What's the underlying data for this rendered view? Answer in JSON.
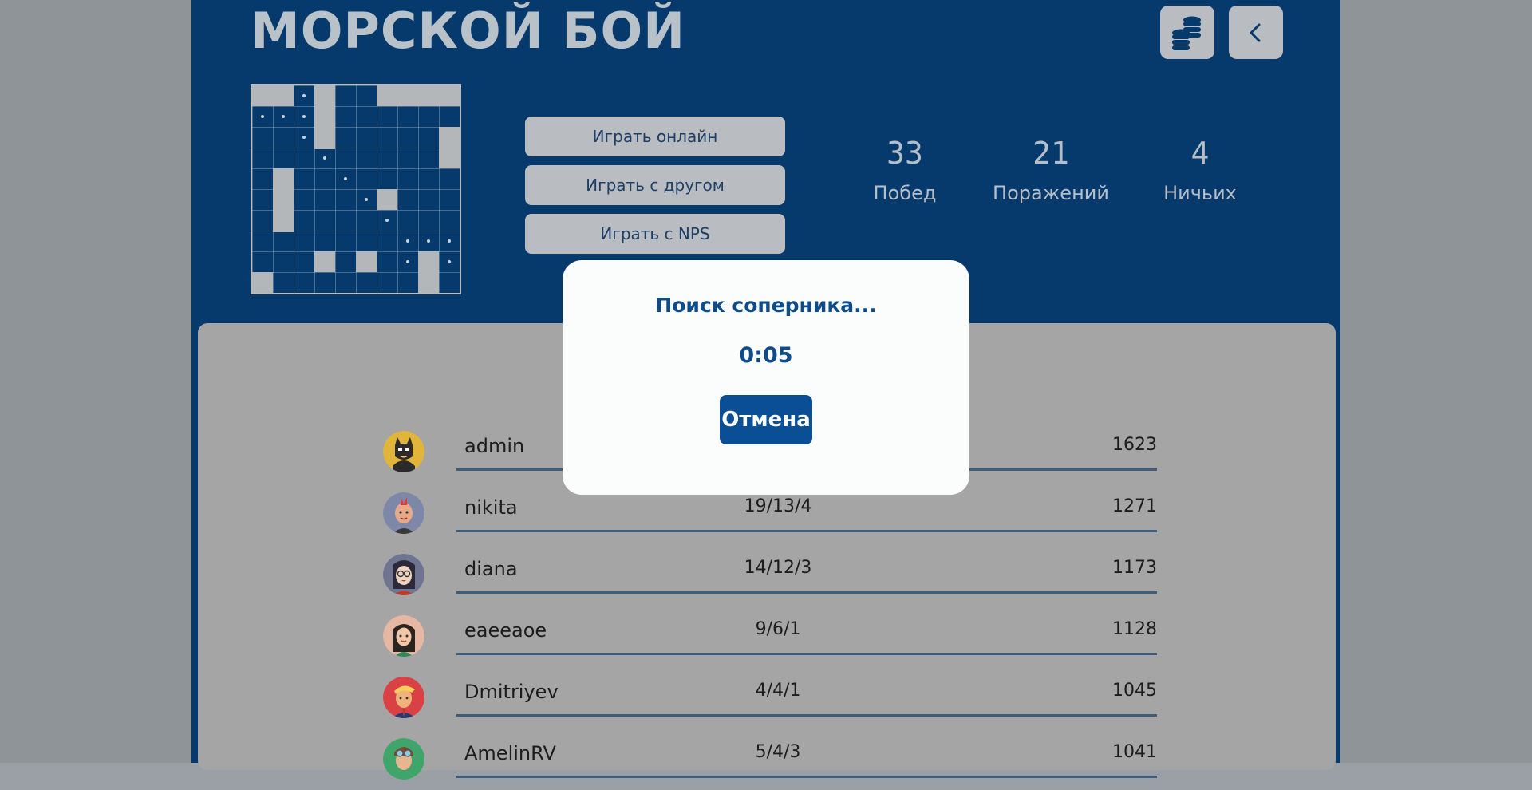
{
  "header": {
    "title": "МОРСКОЙ БОЙ",
    "coins_icon": "coins-icon",
    "back_icon": "chevron-left-icon"
  },
  "menu": {
    "play_online": "Играть онлайн",
    "play_friend": "Играть с другом",
    "play_nps": "Играть с NPS"
  },
  "stats": [
    {
      "value": "33",
      "label": "Побед"
    },
    {
      "value": "21",
      "label": "Поражений"
    },
    {
      "value": "4",
      "label": "Ничьих"
    }
  ],
  "leaderboard": [
    {
      "name": "admin",
      "games": "",
      "score": "1623",
      "avatar": "batman-avatar"
    },
    {
      "name": "nikita",
      "games": "19/13/4",
      "score": "1271",
      "avatar": "punk-avatar"
    },
    {
      "name": "diana",
      "games": "14/12/3",
      "score": "1173",
      "avatar": "glasses-avatar"
    },
    {
      "name": "eaeeaoe",
      "games": "9/6/1",
      "score": "1128",
      "avatar": "girl-avatar"
    },
    {
      "name": "Dmitriyev",
      "games": "4/4/1",
      "score": "1045",
      "avatar": "trump-avatar"
    },
    {
      "name": "AmelinRV",
      "games": "5/4/3",
      "score": "1041",
      "avatar": "pilot-avatar"
    }
  ],
  "modal": {
    "title": "Поиск соперника...",
    "timer": "0:05",
    "cancel_label": "Отмена"
  },
  "colors": {
    "app_background": "#063a6c",
    "accent": "#0a4f96",
    "button": "#b9bcc0"
  }
}
